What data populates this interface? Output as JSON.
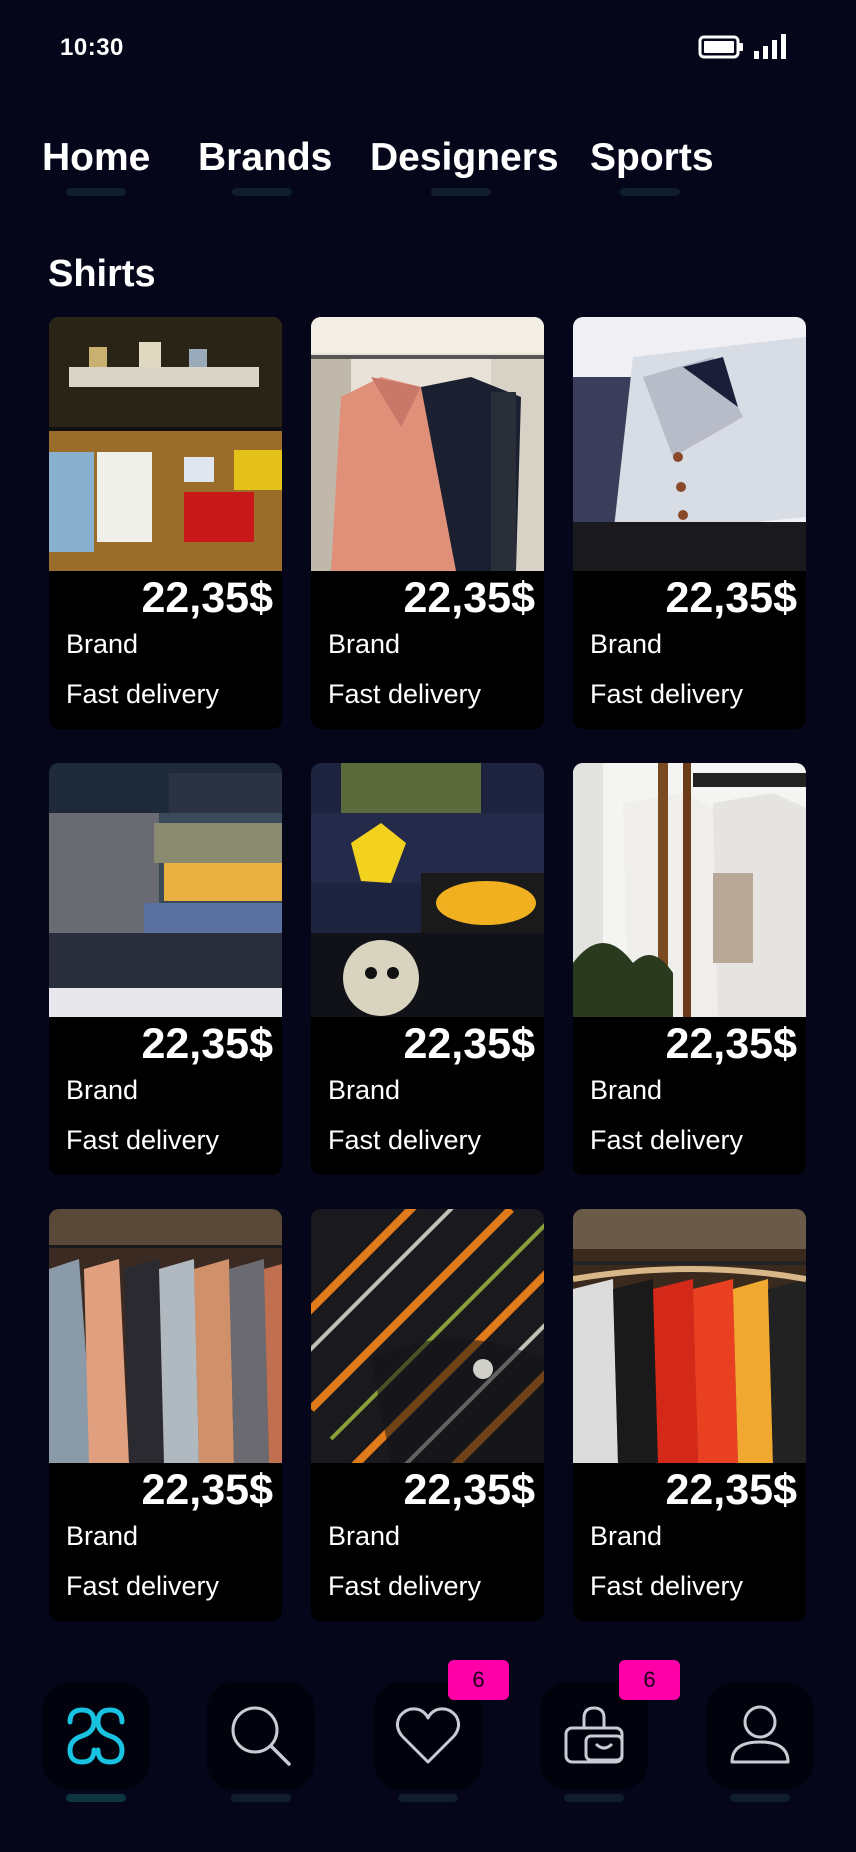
{
  "status_bar": {
    "time": "10:30"
  },
  "top_nav": {
    "tabs": [
      {
        "label": "Home"
      },
      {
        "label": "Brands"
      },
      {
        "label": "Designers"
      },
      {
        "label": "Sports"
      }
    ]
  },
  "section": {
    "title": "Shirts"
  },
  "products": [
    {
      "price": "22,35$",
      "brand": "Brand",
      "delivery": "Fast delivery",
      "image": "clothing-table-display"
    },
    {
      "price": "22,35$",
      "brand": "Brand",
      "delivery": "Fast delivery",
      "image": "shirts-on-hangers-closet"
    },
    {
      "price": "22,35$",
      "brand": "Brand",
      "delivery": "Fast delivery",
      "image": "checkered-dress-shirt"
    },
    {
      "price": "22,35$",
      "brand": "Brand",
      "delivery": "Fast delivery",
      "image": "folded-tshirts-stack"
    },
    {
      "price": "22,35$",
      "brand": "Brand",
      "delivery": "Fast delivery",
      "image": "graphic-tees-pile"
    },
    {
      "price": "22,35$",
      "brand": "Brand",
      "delivery": "Fast delivery",
      "image": "white-tee-on-rack"
    },
    {
      "price": "22,35$",
      "brand": "Brand",
      "delivery": "Fast delivery",
      "image": "shirts-rack-store"
    },
    {
      "price": "22,35$",
      "brand": "Brand",
      "delivery": "Fast delivery",
      "image": "striped-shirt-closeup"
    },
    {
      "price": "22,35$",
      "brand": "Brand",
      "delivery": "Fast delivery",
      "image": "colorful-tees-rack"
    }
  ],
  "bottom_nav": {
    "items": [
      {
        "icon": "home-logo-icon",
        "active": true
      },
      {
        "icon": "search-icon",
        "active": false
      },
      {
        "icon": "heart-icon",
        "active": false,
        "badge": "6"
      },
      {
        "icon": "shopping-bag-icon",
        "active": false,
        "badge": "6"
      },
      {
        "icon": "profile-icon",
        "active": false
      }
    ]
  },
  "colors": {
    "background": "#06061a",
    "card": "#000000",
    "accent": "#19c2e0",
    "badge": "#ff00a8",
    "text": "#ffffff"
  }
}
